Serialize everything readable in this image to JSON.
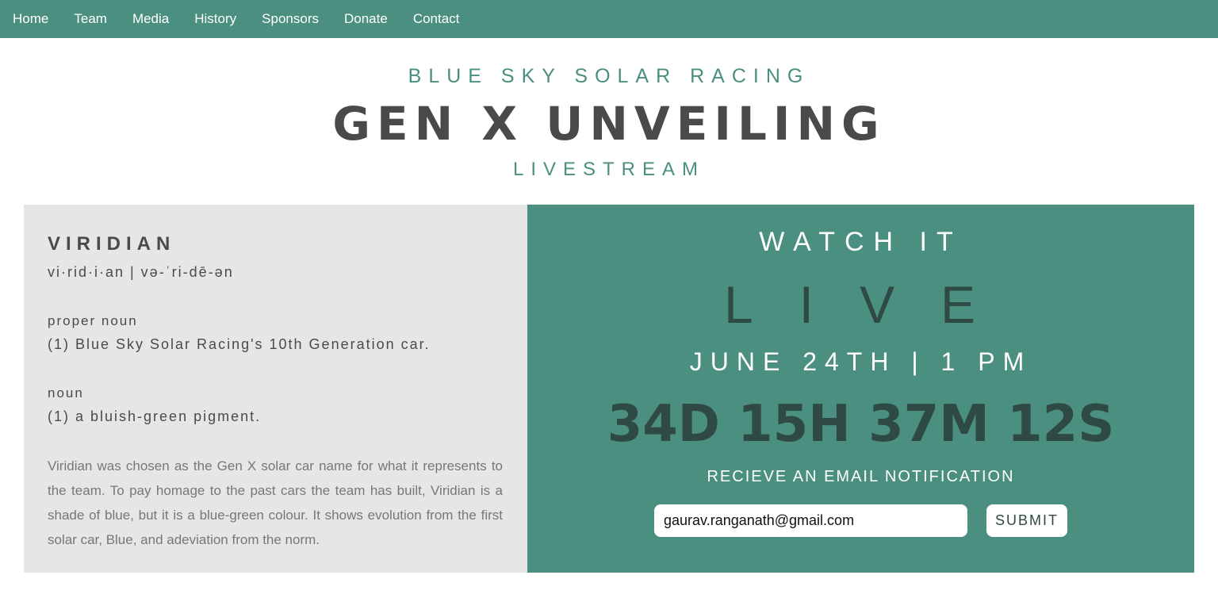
{
  "nav": {
    "items": [
      "Home",
      "Team",
      "Media",
      "History",
      "Sponsors",
      "Donate",
      "Contact"
    ]
  },
  "hero": {
    "org": "BLUE SKY SOLAR RACING",
    "title": "GEN X UNVEILING",
    "subtitle": "LIVESTREAM"
  },
  "definition": {
    "word": "VIRIDIAN",
    "pronunciation": "vi·rid·i·an | və-ˈri-dē-ən",
    "entries": [
      {
        "pos": "proper noun",
        "text": "(1) Blue Sky Solar Racing's 10th Generation car."
      },
      {
        "pos": "noun",
        "text": "(1) a bluish-green pigment."
      }
    ],
    "description": "Viridian was chosen as the Gen X solar car name for what it represents to the team. To pay homage to the past cars the team has built, Viridian is a shade of blue, but it is a blue-green colour. It shows evolution from the first solar car, Blue, and adeviation from the norm."
  },
  "stream": {
    "watch": "WATCH IT",
    "live": "LIVE",
    "date": "JUNE 24TH | 1 PM",
    "countdown": "34D 15H 37M 12S",
    "notify": "RECIEVE AN EMAIL NOTIFICATION",
    "email_value": "gaurav.ranganath@gmail.com",
    "submit": "SUBMIT"
  },
  "colors": {
    "primary": "#4a8f80",
    "dark": "#2f4a44",
    "panel": "#e6e6e6"
  }
}
